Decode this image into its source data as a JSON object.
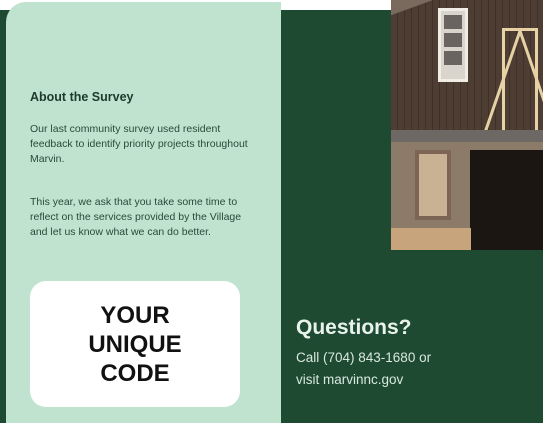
{
  "survey": {
    "heading": "About the Survey",
    "paragraph_1": "Our last community survey used resident feedback to identify priority projects throughout Marvin.",
    "paragraph_2": "This year, we ask that you take some time to reflect on the services provided by the Village and let us know what we can do better."
  },
  "code_box": {
    "text": "YOUR\nUNIQUE\nCODE"
  },
  "questions": {
    "heading": "Questions?",
    "line_1": "Call (704) 843-1680 or",
    "line_2": "visit marvinnc.gov"
  },
  "colors": {
    "dark_green": "#1e4a31",
    "light_green": "#bfe3cf",
    "white": "#ffffff"
  }
}
